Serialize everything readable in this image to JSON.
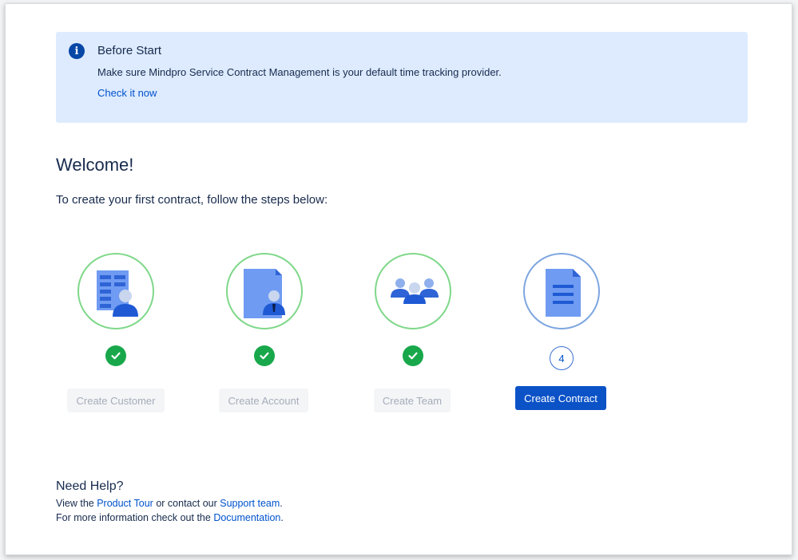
{
  "notice": {
    "title": "Before Start",
    "text": "Make sure Mindpro Service Contract Management is your default time tracking provider.",
    "link": "Check it now"
  },
  "welcome": {
    "title": "Welcome!",
    "intro": "To create your first contract, follow the steps below:"
  },
  "steps": [
    {
      "label": "Create Customer",
      "status": "done",
      "icon": "customer-icon"
    },
    {
      "label": "Create Account",
      "status": "done",
      "icon": "account-icon"
    },
    {
      "label": "Create Team",
      "status": "done",
      "icon": "team-icon"
    },
    {
      "label": "Create Contract",
      "status": "current",
      "number": "4",
      "icon": "contract-icon"
    }
  ],
  "help": {
    "title": "Need Help?",
    "line1_pre": "View the ",
    "line1_link1": "Product Tour",
    "line1_mid": " or contact our ",
    "line1_link2": "Support team",
    "line1_post": ".",
    "line2_pre": "For more information check out the ",
    "line2_link": "Documentation",
    "line2_post": "."
  },
  "colors": {
    "accent": "#0052cc",
    "primary_button": "#0b52c7",
    "done_green": "#18a84b",
    "notice_bg": "#deebff",
    "icon_blue": "#5f8ef0"
  }
}
